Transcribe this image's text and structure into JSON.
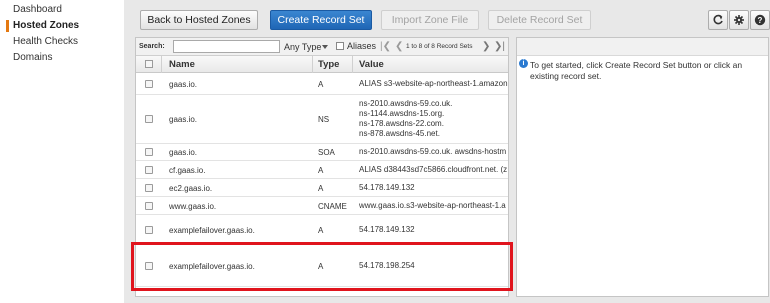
{
  "sidebar": {
    "items": [
      {
        "label": "Dashboard",
        "active": false
      },
      {
        "label": "Hosted Zones",
        "active": true
      },
      {
        "label": "Health Checks",
        "active": false
      },
      {
        "label": "Domains",
        "active": false
      }
    ]
  },
  "toolbar": {
    "back_label": "Back to Hosted Zones",
    "create_label": "Create Record Set",
    "import_label": "Import Zone File",
    "delete_label": "Delete Record Set",
    "refresh_icon": "refresh-icon",
    "settings_icon": "gear-icon",
    "help_icon": "help-icon"
  },
  "filter": {
    "search_label": "Search:",
    "search_value": "",
    "type_label": "Any Type",
    "aliases_label": "Aliases",
    "pagination_text": "1 to 8 of 8 Record Sets"
  },
  "table": {
    "columns": [
      "Name",
      "Type",
      "Value"
    ],
    "rows": [
      {
        "name": "gaas.io.",
        "type": "A",
        "value": [
          "ALIAS s3-website-ap-northeast-1.amazon"
        ]
      },
      {
        "name": "gaas.io.",
        "type": "NS",
        "value": [
          "ns-2010.awsdns-59.co.uk.",
          "ns-1144.awsdns-15.org.",
          "ns-178.awsdns-22.com.",
          "ns-878.awsdns-45.net."
        ]
      },
      {
        "name": "gaas.io.",
        "type": "SOA",
        "value": [
          "ns-2010.awsdns-59.co.uk. awsdns-hostm"
        ]
      },
      {
        "name": "cf.gaas.io.",
        "type": "A",
        "value": [
          "ALIAS d38443sd7c5866.cloudfront.net. (z"
        ]
      },
      {
        "name": "ec2.gaas.io.",
        "type": "A",
        "value": [
          "54.178.149.132"
        ]
      },
      {
        "name": "www.gaas.io.",
        "type": "CNAME",
        "value": [
          "www.gaas.io.s3-website-ap-northeast-1.a"
        ]
      },
      {
        "name": "examplefailover.gaas.io.",
        "type": "A",
        "value": [
          "54.178.149.132"
        ]
      },
      {
        "name": "examplefailover.gaas.io.",
        "type": "A",
        "value": [
          "54.178.198.254"
        ]
      }
    ]
  },
  "right_panel": {
    "info_text": "To get started, click Create Record Set button or click an existing record set."
  },
  "colors": {
    "primary_button": "#2a73c2",
    "active_accent": "#e47911",
    "highlight": "#e0141d"
  }
}
